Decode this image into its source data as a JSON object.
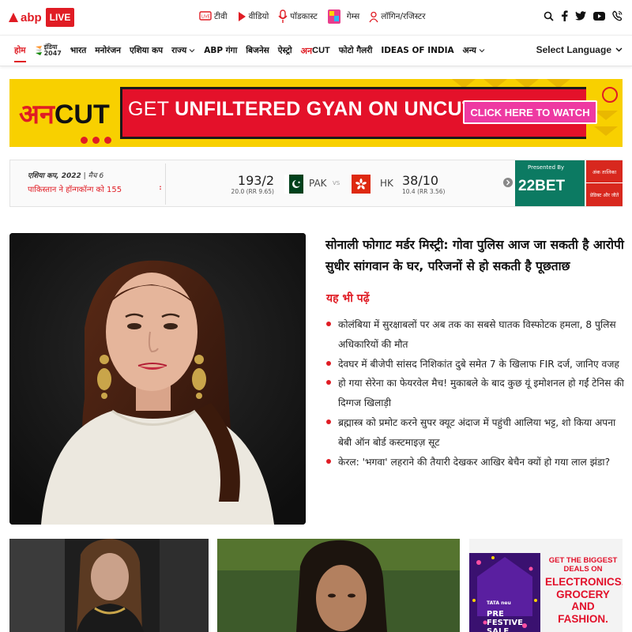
{
  "brand": {
    "logo_text": "abp",
    "live": "LIVE"
  },
  "topnav": [
    {
      "label": "टीवी",
      "icon": "live-tv-icon"
    },
    {
      "label": "वीडियो",
      "icon": "play-icon"
    },
    {
      "label": "पॉडकास्ट",
      "icon": "microphone-icon"
    },
    {
      "label": "गेम्स",
      "icon": "games-icon"
    },
    {
      "label": "लॉगिन/रजिस्टर",
      "icon": "user-icon"
    }
  ],
  "social_icons": [
    "search-icon",
    "facebook-icon",
    "twitter-icon",
    "youtube-icon",
    "phone-icon"
  ],
  "nav": {
    "items": [
      "होम",
      "भारत",
      "मनोरंजन",
      "एशिया कप",
      "राज्य",
      "ABP गंगा",
      "बिजनेस",
      "ऐस्ट्रो",
      "अनCUT",
      "फोटो गैलरी",
      "IDEAS OF INDIA",
      "अन्य"
    ],
    "india2047": "इंडिया",
    "india2047_year": "2047",
    "language": "Select Language"
  },
  "banner": {
    "logo_red": "अन",
    "logo_black": "CUT",
    "title_prefix": "GET ",
    "title": "UNFILTERED GYAN ON UNCUT",
    "cta": "CLICK HERE TO WATCH"
  },
  "score": {
    "series": "एशिया कप, 2022",
    "match": "मैच 6",
    "result": "पाकिस्तान ने हॉन्गकॉन्ग को 155",
    "team1": {
      "name": "PAK",
      "score": "193/2",
      "overs": "20.0 (RR 9.65)"
    },
    "vs": "VS",
    "team2": {
      "name": "HK",
      "score": "38/10",
      "overs": "10.4 (RR 3.56)"
    },
    "presented_by": "Presented By",
    "sponsor": "22BET",
    "btn_points": "अंक तालिका",
    "btn_predict": "प्रेडिक्ट और जीतें",
    "colors": {
      "pak_flag": "#01411c",
      "hk_flag": "#de2910",
      "sponsor_bg": "#0c7a62"
    }
  },
  "main_story": {
    "headline": "सोनाली फोगाट मर्डर मिस्ट्री: गोवा पुलिस आज जा सकती है आरोपी सुधीर सांगवान के घर, परिजनों से हो सकती है पूछताछ",
    "also_read": "यह भी पढ़ें",
    "related": [
      "कोलंबिया में सुरक्षाबलों पर अब तक का सबसे घातक विस्फोटक हमला, 8 पुलिस अधिकारियों की मौत",
      "देवघर में बीजेपी सांसद निशिकांत दुबे समेत 7 के खिलाफ FIR दर्ज, जानिए वजह",
      "हो गया सेरेना का फेयरवेल मैच! मुकाबले के बाद कुछ यूं इमोशनल हो गईं टेनिस की दिग्गज खिलाड़ी",
      "ब्रह्मास्त्र को प्रमोट करने सुपर क्यूट अंदाज में पहुंची आलिया भट्ट, शो किया अपना बेबी ऑन बोर्ड कस्टमाइज़ सूट",
      "केरल: 'भगवा' लहराने की तैयारी देखकर आखिर बेचैन क्यों हो गया लाल झंडा?"
    ]
  },
  "ad": {
    "brand": "TATA neu",
    "sale": "PRE FESTIVE SALE",
    "headline": "GET THE BIGGEST DEALS ON",
    "categories": "ELECTRONICS, GROCERY AND FASHION."
  },
  "colors": {
    "accent": "#e01c24",
    "banner_yellow": "#f8d000",
    "cta_pink": "#ee3aa2"
  }
}
